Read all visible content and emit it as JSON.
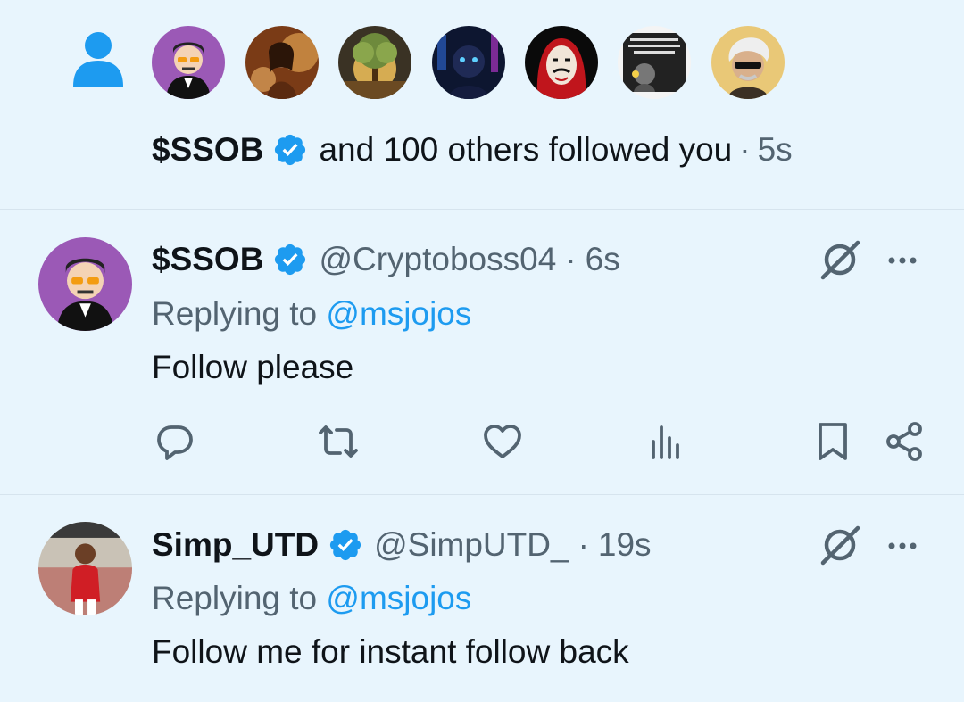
{
  "notification": {
    "icon": "person-icon",
    "avatars": [
      "avatar-cartoon-man-glasses",
      "avatar-woman-lights",
      "avatar-golden-tree",
      "avatar-neon-face",
      "avatar-red-hood-mask",
      "avatar-text-post",
      "avatar-white-hair-sunglasses"
    ],
    "name": "$SSOB",
    "text": "and 100 others followed you",
    "separator": "·",
    "time": "5s"
  },
  "tweets": [
    {
      "name": "$SSOB",
      "handle": "@Cryptoboss04",
      "separator": "·",
      "time": "6s",
      "replying_prefix": "Replying to",
      "replying_to": "@msjojos",
      "body": "Follow please",
      "avatar": "avatar-cartoon-man-glasses"
    },
    {
      "name": "Simp_UTD",
      "handle": "@SimpUTD_",
      "separator": "·",
      "time": "19s",
      "replying_prefix": "Replying to",
      "replying_to": "@msjojos",
      "body": "Follow me for instant follow back",
      "avatar": "avatar-footballer-red"
    }
  ],
  "colors": {
    "background": "#e8f5fd",
    "accent": "#1d9bf0",
    "text": "#0f1419",
    "secondary": "#536471"
  }
}
